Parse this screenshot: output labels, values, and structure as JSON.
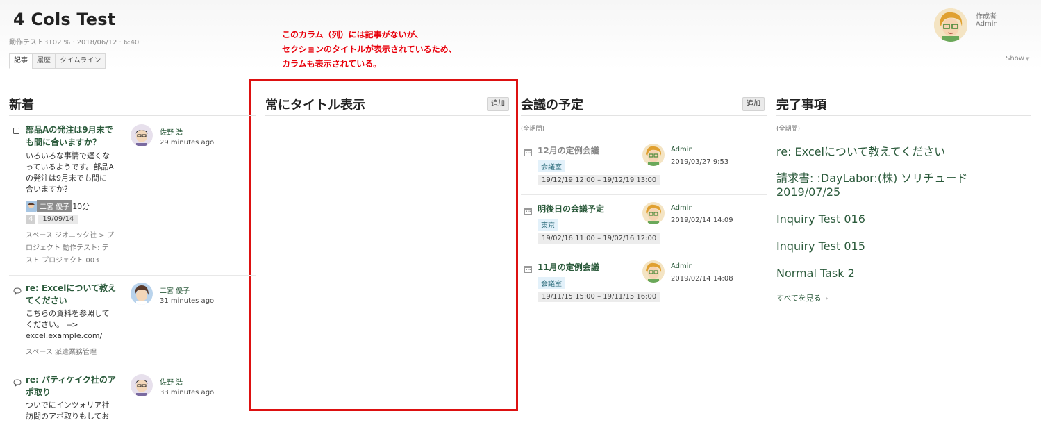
{
  "page": {
    "title": "4 Cols Test",
    "meta": "動作テスト3102 % · 2018/06/12 · 6:40",
    "tabs": [
      "記事",
      "履歴",
      "タイムライン"
    ],
    "author_label": "作成者",
    "author_name": "Admin",
    "show_label": "Show"
  },
  "annotation": "このカラム（列）には記事がないが、\nセクションのタイトルが表示されているため、\nカラムも表示されている。",
  "columns": {
    "new": {
      "title": "新着",
      "items": [
        {
          "title_lines": [
            "部品Aの発注は9月末で",
            "も間に合いますか？"
          ],
          "body_lines": [
            "いろいろな事情で遅くな",
            "っているようです。部品A",
            "の発注は9月末でも間に",
            "合いますか？"
          ],
          "user": "佐野 浩",
          "time": "29 minutes ago",
          "assignee": "二宮 優子",
          "estimate": "10分",
          "count": "4",
          "date": "19/09/14",
          "space_lines": [
            "スペース ジオニック社 > プ",
            "ロジェクト 動作テスト: テ",
            "スト プロジェクト 003"
          ]
        },
        {
          "title_lines": [
            "re: Excelについて教え",
            "てください"
          ],
          "body_lines": [
            "こちらの資料を参照して",
            "ください。 -->",
            "excel.example.com/"
          ],
          "user": "二宮 優子",
          "time": "31 minutes ago",
          "space_lines": [
            "スペース 派遣業務管理"
          ]
        },
        {
          "title_lines": [
            "re: パティケイク社のア",
            "ポ取り"
          ],
          "body_lines": [
            "ついでにインツォリア社",
            "訪問のアポ取りもしてお"
          ],
          "user": "佐野 浩",
          "time": "33 minutes ago"
        }
      ]
    },
    "always": {
      "title": "常にタイトル表示",
      "add_label": "追加"
    },
    "meetings": {
      "title": "会議の予定",
      "add_label": "追加",
      "period": "(全期間)",
      "items": [
        {
          "title": "12月の定例会議",
          "tag": "会議室",
          "time": "19/12/19 12:00 – 19/12/19 13:00",
          "user": "Admin",
          "date": "2019/03/27 9:53",
          "muted": true
        },
        {
          "title": "明後日の会議予定",
          "tag": "東京",
          "time": "19/02/16 11:00 – 19/02/16 12:00",
          "user": "Admin",
          "date": "2019/02/14 14:09",
          "muted": false
        },
        {
          "title": "11月の定例会議",
          "tag": "会議室",
          "time": "19/11/15 15:00 – 19/11/15 16:00",
          "user": "Admin",
          "date": "2019/02/14 14:08",
          "muted": false
        }
      ]
    },
    "done": {
      "title": "完了事項",
      "period": "(全期間)",
      "items": [
        "re: Excelについて教えてください",
        "請求書: :DayLabor:(株) ソリチュード\n2019/07/25",
        "Inquiry Test 016",
        "Inquiry Test 015",
        "Normal Task 2"
      ],
      "see_all": "すべてを見る"
    }
  },
  "colors": {
    "link_green": "#2b5a3b",
    "annotation_red": "#e8000b",
    "highlight_box": "#dd1111"
  }
}
